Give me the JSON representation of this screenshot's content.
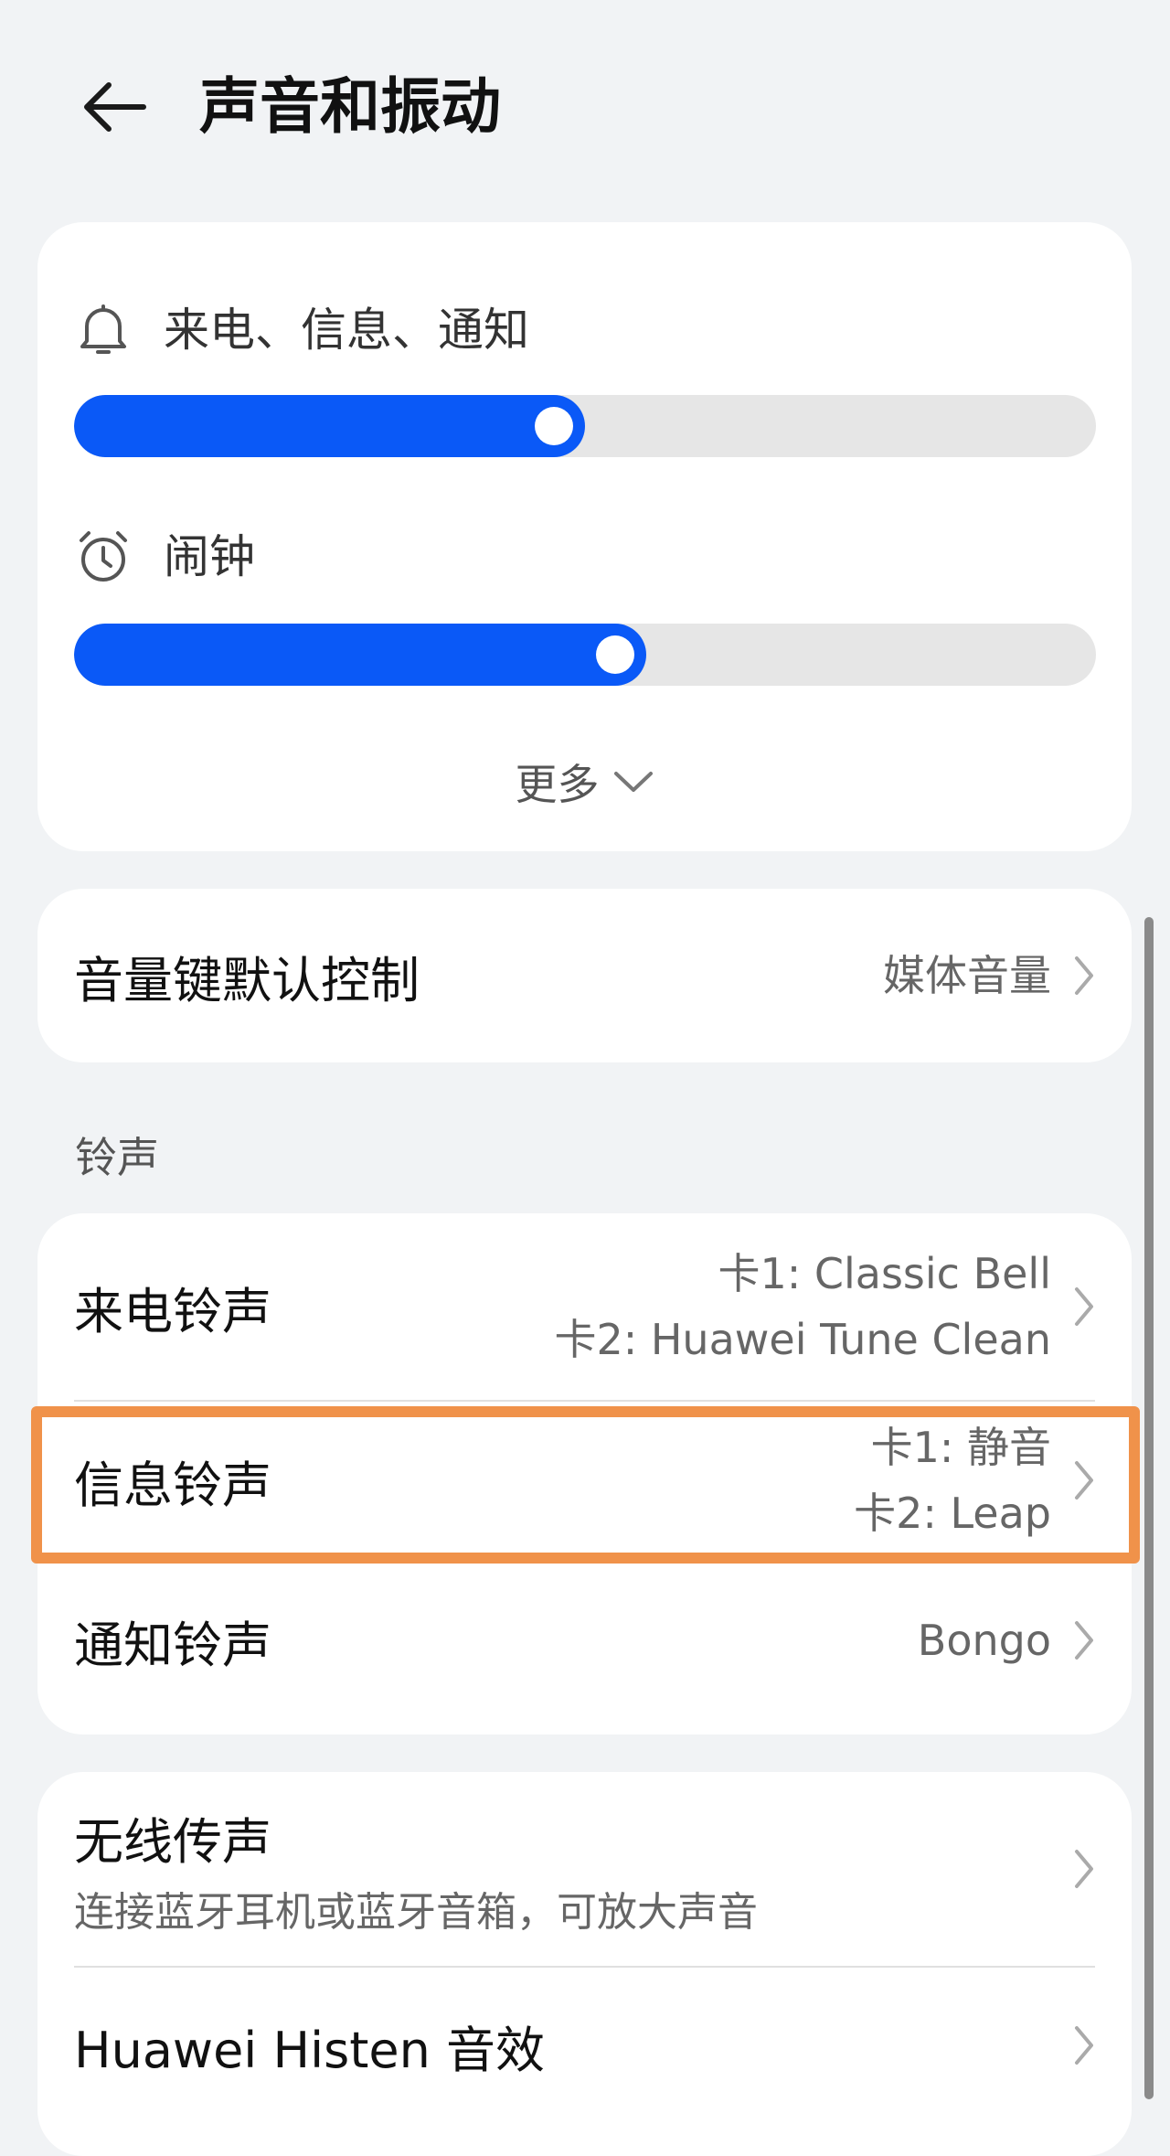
{
  "header": {
    "title": "声音和振动"
  },
  "volume": {
    "ringtone_label": "来电、信息、通知",
    "ringtone_level": 0.5,
    "alarm_label": "闹钟",
    "alarm_level": 0.56,
    "more_label": "更多"
  },
  "volume_key": {
    "title": "音量键默认控制",
    "value": "媒体音量"
  },
  "ringtones": {
    "section_label": "铃声",
    "call": {
      "title": "来电铃声",
      "sim1": "卡1: Classic Bell",
      "sim2": "卡2: Huawei Tune Clean"
    },
    "message": {
      "title": "信息铃声",
      "sim1": "卡1: 静音",
      "sim2": "卡2: Leap"
    },
    "notification": {
      "title": "通知铃声",
      "value": "Bongo"
    }
  },
  "extras": {
    "wireless": {
      "title": "无线传声",
      "subtitle": "连接蓝牙耳机或蓝牙音箱，可放大声音"
    },
    "histen": {
      "title": "Huawei Histen 音效"
    }
  },
  "colors": {
    "accent": "#0a59f7",
    "highlight": "#f0924a"
  }
}
